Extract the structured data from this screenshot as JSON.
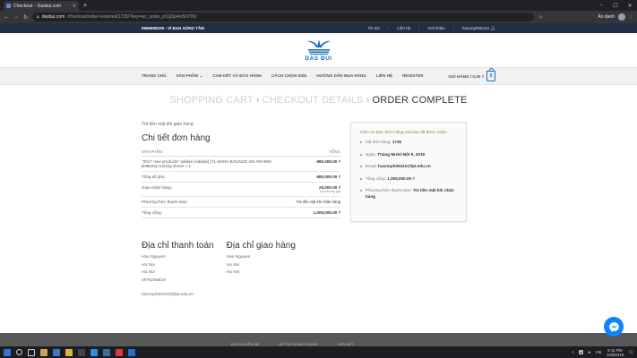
{
  "browser": {
    "tab_title": "Checkout – Dasbui.com",
    "url_domain": "dasbui.com",
    "url_path": "/checkout/order-received/1735/?key=wc_order_pCQ6p4nlSh7DU",
    "profile_label": "Ẩn danh"
  },
  "topbar": {
    "phone": "0966699226",
    "slogan": "VÌ BẠN XỨNG TẦM",
    "links": [
      "Tin tức",
      "Liên hệ",
      "Giới thiệu"
    ],
    "username": "haonnph05410"
  },
  "brand": {
    "name": "DAS BUI",
    "color": "#1b6fb8"
  },
  "nav": {
    "items": [
      "TRANG CHỦ",
      "SẢN PHẨM",
      "CAM KẾT VÀ BẢO HÀNH",
      "CÁCH CHỌN SIZE",
      "HƯỚNG DẪN MUA HÀNG",
      "LIÊN HỆ",
      "REGISTER"
    ],
    "cart_label": "GIỎ HÀNG / 0,00 ₫",
    "cart_count": "0"
  },
  "steps": {
    "step1": "SHOPPING CART",
    "step2": "CHECKOUT DETAILS",
    "step3": "ORDER COMPLETE"
  },
  "order": {
    "payment_note": "Trả tiền mặt khi giao hàng",
    "title": "Chi tiết đơn hàng",
    "col_product": "SẢN PHẨM",
    "col_total": "TỔNG",
    "product_name": "\"2017 new products\" adidas (Adidas) [71 MANA BOUNCE 2W ARAMIS B39024] running shoes × 1",
    "product_price": "980,000.00 ₫",
    "rows": [
      {
        "label": "Tổng số phụ:",
        "value": "980,000.00 ₫",
        "sub": ""
      },
      {
        "label": "Giao nhận hàng:",
        "value": "25,000.00 ₫",
        "sub": "qua Đồng giá"
      },
      {
        "label": "Phương thức thanh toán:",
        "value": "Trả tiền mặt khi nhận hàng",
        "sub": ""
      },
      {
        "label": "Tổng cộng:",
        "value": "1,005,000.00 ₫",
        "sub": ""
      }
    ]
  },
  "billing": {
    "title": "Địa chỉ thanh toán",
    "name": "Hao Nguyen",
    "line1": "Ha Noi",
    "line2": "Ha Noi",
    "phone": "0975256819",
    "email": "haonnph05410@fpt.edu.vn"
  },
  "shipping": {
    "title": "Địa chỉ giao hàng",
    "name": "Hao Nguyen",
    "line1": "Ha Noi",
    "line2": "Ha Noi"
  },
  "summary": {
    "thanks": "Cảm ơn bạn. Đơn hàng của bạn đã được nhận.",
    "order_no_label": "Mã đơn hàng:",
    "order_no": "1735",
    "date_label": "Ngày:",
    "date": "Tháng Mười Một 9, 2019",
    "email_label": "Email:",
    "email": "haonnph05410@fpt.edu.vn",
    "total_label": "Tổng cộng:",
    "total": "1,005,000.00 ₫",
    "method_label": "Phương thức thanh toán:",
    "method": "Trả tiền mặt khi nhận hàng"
  },
  "footer": {
    "col1": "ĐỊA CHỈ LIÊN HỆ",
    "col2": "HỖ TRỢ KHÁCH HÀNG",
    "col3": "LIÊN KẾT"
  },
  "taskbar": {
    "lang": "VIE",
    "time": "5:11 PM",
    "date": "11/9/2019"
  },
  "colors": {
    "topbar": "#1f2f45",
    "accent": "#1b6fb8",
    "thanks": "#5e9b3a",
    "messenger": "#0d84ff"
  }
}
